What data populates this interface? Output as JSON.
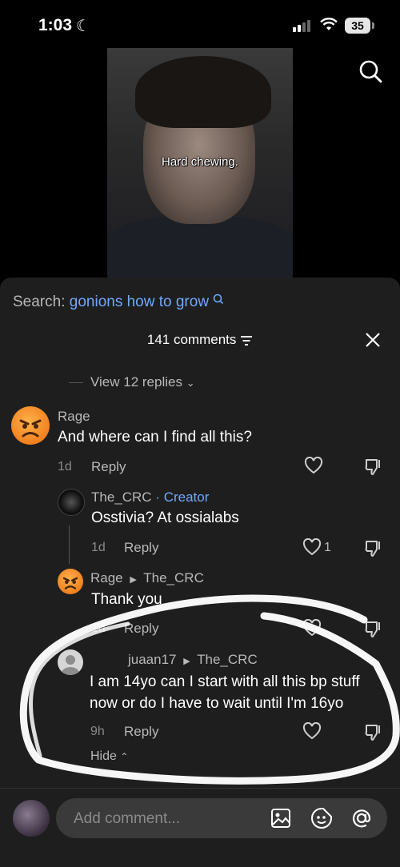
{
  "status": {
    "time": "1:03",
    "battery": "35"
  },
  "video": {
    "caption": "Hard chewing."
  },
  "search": {
    "label": "Search:",
    "query": "gonions how to grow"
  },
  "comments_header": {
    "count_label": "141 comments"
  },
  "view_replies": "View 12 replies",
  "comments": [
    {
      "user": "Rage",
      "text": "And where can I find all this?",
      "age": "1d",
      "reply_label": "Reply"
    },
    {
      "user": "The_CRC",
      "badge": "· Creator",
      "text": "Osstivia? At ossialabs",
      "age": "1d",
      "reply_label": "Reply",
      "likes": "1"
    },
    {
      "user": "Rage",
      "reply_to": "The_CRC",
      "text": "Thank you",
      "age": "1d",
      "reply_label": "Reply"
    },
    {
      "user": "juaan17",
      "reply_to": "The_CRC",
      "text_line1": "I am 14yo can I start with all this bp stuff",
      "text_line2": "now or do I have to wait until I'm 16yo",
      "age": "9h",
      "reply_label": "Reply"
    }
  ],
  "hide_label": "Hide",
  "bottom": {
    "placeholder": "Add comment..."
  },
  "colors": {
    "link": "#6fa8ff",
    "sheet": "#1e1e1e"
  }
}
